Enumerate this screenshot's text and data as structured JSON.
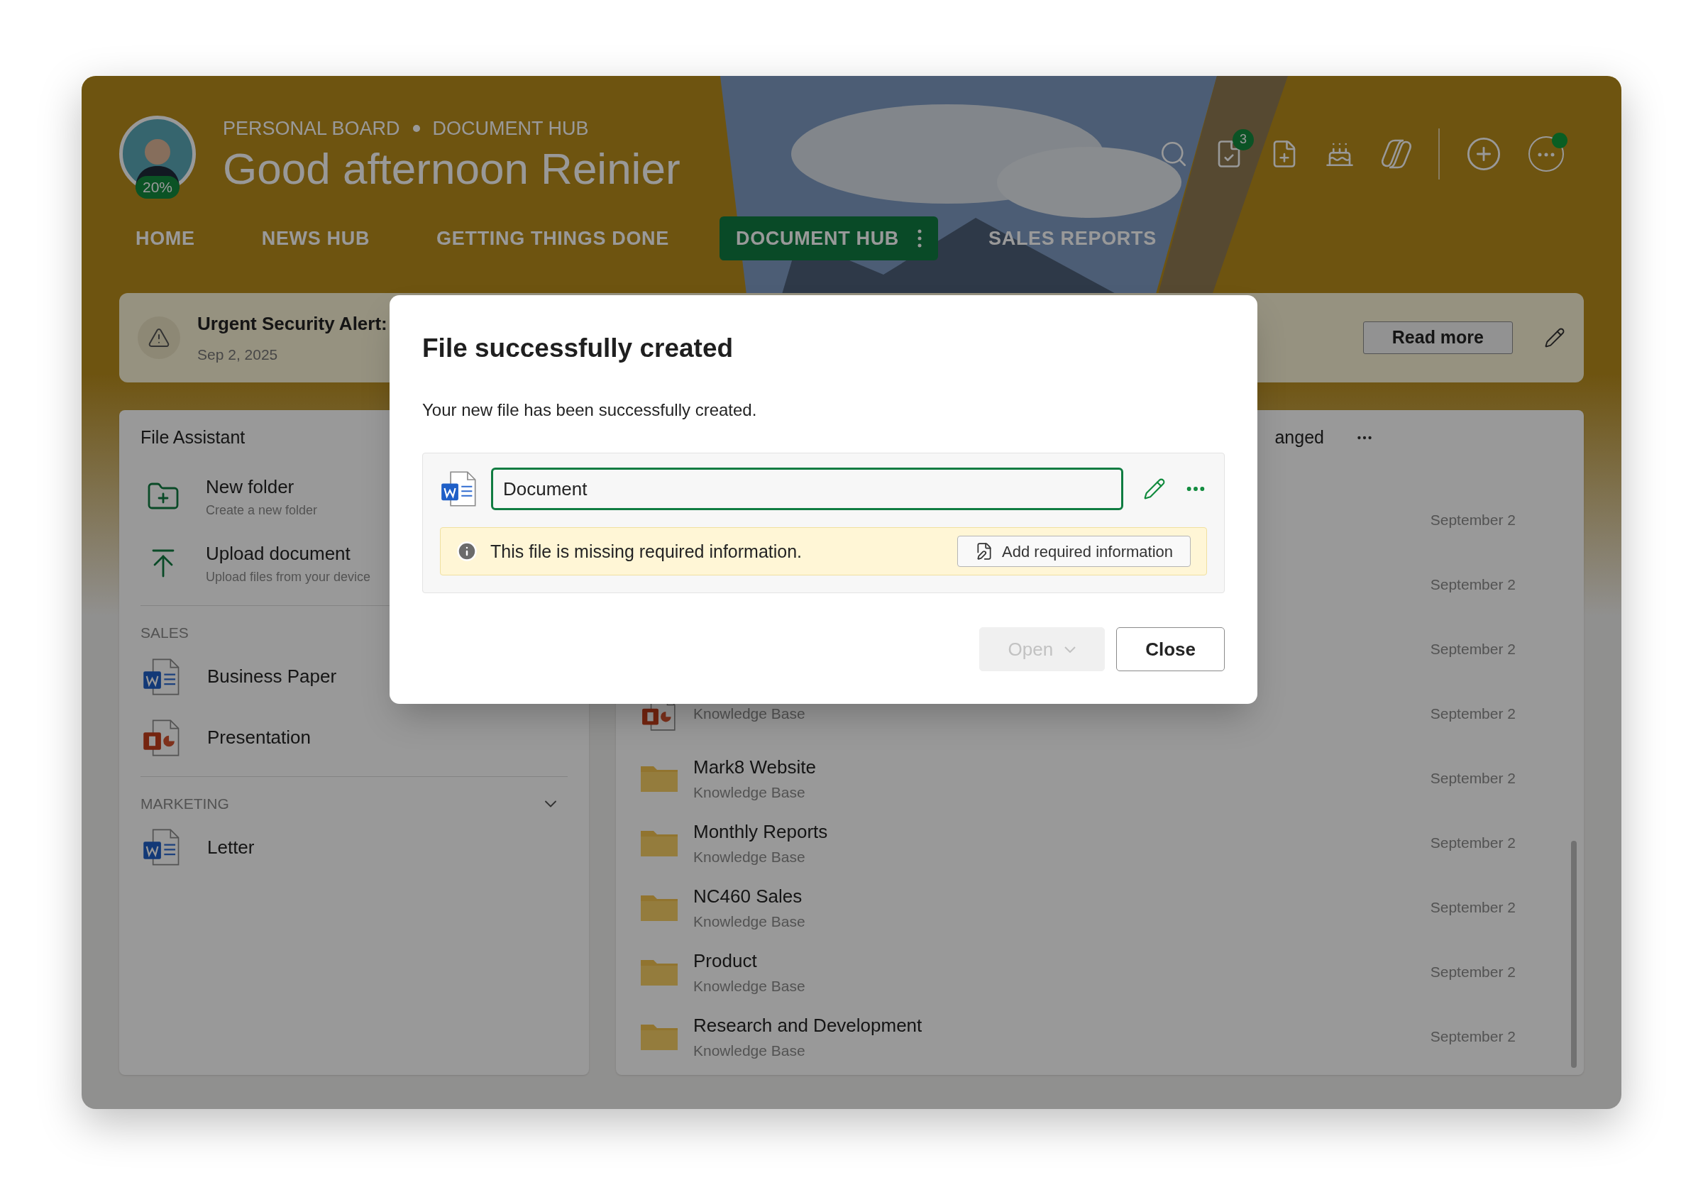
{
  "header": {
    "avatar_badge": "20%",
    "breadcrumb": [
      "PERSONAL BOARD",
      "DOCUMENT HUB"
    ],
    "greeting": "Good afternoon Reinier",
    "task_badge": "3",
    "status_dot": true
  },
  "nav": [
    {
      "label": "HOME",
      "selected": false
    },
    {
      "label": "NEWS HUB",
      "selected": false
    },
    {
      "label": "GETTING THINGS DONE",
      "selected": false
    },
    {
      "label": "DOCUMENT HUB",
      "selected": true
    },
    {
      "label": "SALES REPORTS",
      "selected": false
    }
  ],
  "alert": {
    "title": "Urgent Security Alert:",
    "date": "Sep 2, 2025",
    "button": "Read more"
  },
  "file_assistant": {
    "title": "File Assistant",
    "actions": [
      {
        "kind": "folder",
        "label": "New folder",
        "description": "Create a new folder"
      },
      {
        "kind": "upload",
        "label": "Upload document",
        "description": "Upload files from your device"
      }
    ],
    "sections": [
      {
        "heading": "SALES",
        "kind": "plain",
        "items": [
          {
            "kind": "word",
            "label": "Business Paper"
          },
          {
            "kind": "powerpoint",
            "label": "Presentation"
          }
        ]
      },
      {
        "heading": "MARKETING",
        "kind": "collapsible",
        "items": [
          {
            "kind": "word",
            "label": "Letter"
          }
        ]
      }
    ]
  },
  "files": {
    "column_header": "anged",
    "rows": [
      {
        "date": "September 2"
      },
      {
        "date": "September 2"
      },
      {
        "date": "September 2"
      },
      {
        "kind": "powerpoint",
        "location": "Knowledge Base",
        "date": "September 2"
      },
      {
        "kind": "folder",
        "name": "Mark8 Website",
        "location": "Knowledge Base",
        "date": "September 2"
      },
      {
        "kind": "folder",
        "name": "Monthly Reports",
        "location": "Knowledge Base",
        "date": "September 2"
      },
      {
        "kind": "folder",
        "name": "NC460 Sales",
        "location": "Knowledge Base",
        "date": "September 2"
      },
      {
        "kind": "folder",
        "name": "Product",
        "location": "Knowledge Base",
        "date": "September 2"
      },
      {
        "kind": "folder",
        "name": "Research and Development",
        "location": "Knowledge Base",
        "date": "September 2"
      }
    ]
  },
  "dialog": {
    "title": "File successfully created",
    "message": "Your new file has been successfully created.",
    "file": {
      "kind": "word",
      "name": "Document"
    },
    "warning": {
      "text": "This file is missing required information.",
      "action": "Add required information"
    },
    "buttons": [
      {
        "kind": "split",
        "label": "Open",
        "disabled": true
      },
      {
        "kind": "plain",
        "label": "Close",
        "disabled": false
      }
    ]
  }
}
